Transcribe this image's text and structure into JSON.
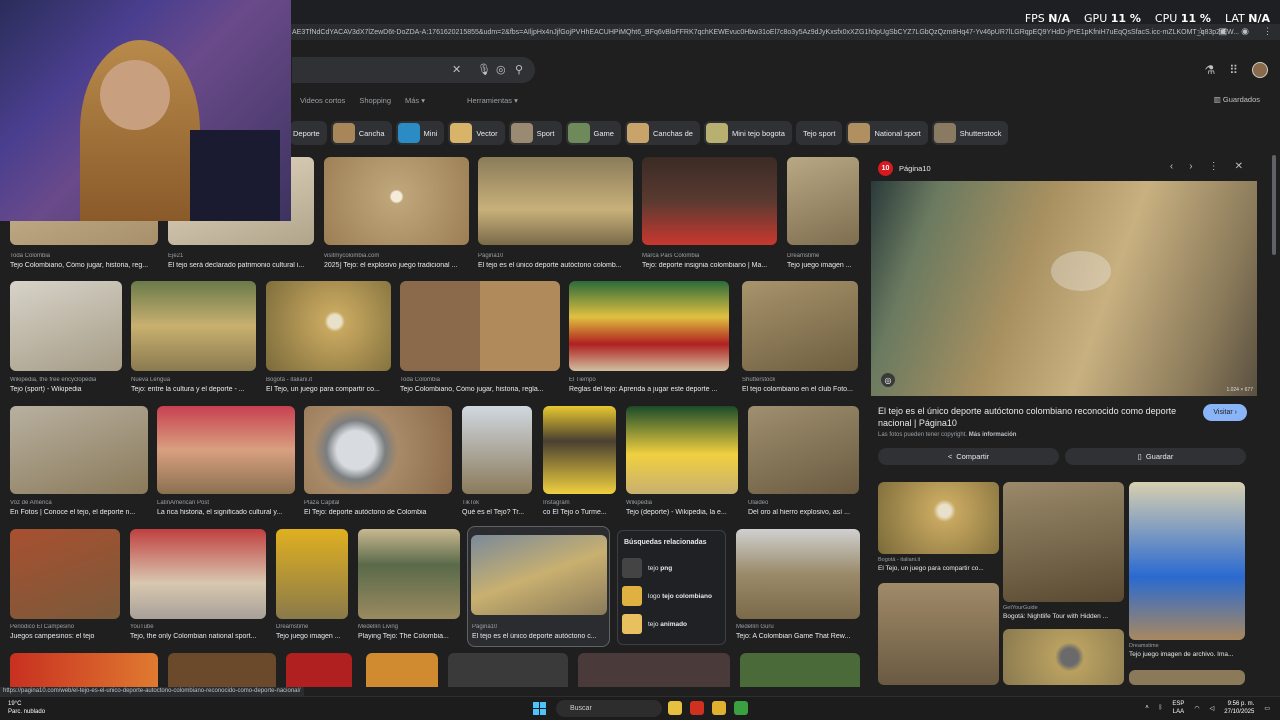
{
  "overlay": {
    "fps_label": "FPS",
    "fps": "N/A",
    "gpu_label": "GPU",
    "gpu": "11 %",
    "cpu_label": "CPU",
    "cpu": "11 %",
    "lat_label": "LAT",
    "lat": "N/A"
  },
  "browser": {
    "url": "AE3TfNdCdYACAV3dX7lZewD6t-DoZDA-A:1761620215855&udm=2&fbs=AIljpHx4nJjfGojPVHhEACUHPiMQht6_BFq6vBloFFRK7qchKEWEvuc0Hbw31oEl7c8o3y5Az9dJyKxsfx0xXZG1h0pUgSbCYZ7LGbQzQzm8Hq47-Yv46pUR7lLGRqpEQ9YHdD-jPrE1pKfniH7uEqQsSfacS.icc-mZLKOMT_q83p2rEW..."
  },
  "search": {
    "nav_tabs": [
      "Videos cortos",
      "Shopping",
      "Más ▾",
      "Herramientas ▾"
    ],
    "saved": "Guardados"
  },
  "chips": [
    "Deporte",
    "Cancha",
    "Mini",
    "Vector",
    "Sport",
    "Game",
    "Canchas de",
    "Mini tejo bogota",
    "Tejo sport",
    "National sport",
    "Shutterstock"
  ],
  "row1": [
    {
      "src": "Toda Colombia",
      "cap": "Tejo Colombiano, Cómo jugar, historia, reg..."
    },
    {
      "src": "Eje21",
      "cap": "El tejo será declarado patrimonio cultural i..."
    },
    {
      "src": "visitmycolombia.com",
      "cap": "2025] Tejo: el explosivo juego tradicional ..."
    },
    {
      "src": "Página10",
      "cap": "El tejo es el único deporte autóctono colomb..."
    },
    {
      "src": "Marca País Colombia",
      "cap": "Tejo: deporte insignia colombiano | Ma..."
    },
    {
      "src": "Dreamstime",
      "cap": "Tejo juego imagen ..."
    }
  ],
  "row2": [
    {
      "src": "Wikipedia, the free encyclopedia",
      "cap": "Tejo (sport) - Wikipedia"
    },
    {
      "src": "Nueva Lengua",
      "cap": "Tejo: entre la cultura y el deporte - ..."
    },
    {
      "src": "Bogotá - italiani.it",
      "cap": "El Tejo, un juego para compartir co..."
    },
    {
      "src": "Toda Colombia",
      "cap": "Tejo Colombiano, Cómo jugar, historia, regla..."
    },
    {
      "src": "El Tiempo",
      "cap": "Reglas del tejo: Aprenda a jugar este deporte ..."
    },
    {
      "src": "Shutterstock",
      "cap": "El tejo colombiano en el club Foto..."
    }
  ],
  "row3": [
    {
      "src": "Voz de América",
      "cap": "En Fotos | Conoce el tejo, el deporte n..."
    },
    {
      "src": "LatinAmerican Post",
      "cap": "La rica historia, el significado cultural y..."
    },
    {
      "src": "Plaza Capital",
      "cap": "El Tejo: deporte autóctono de Colombia"
    },
    {
      "src": "TikTok",
      "cap": "Qué es el Tejo? Tr..."
    },
    {
      "src": "Instagram",
      "cap": "co El Tejo o Turme..."
    },
    {
      "src": "Wikipedia",
      "cap": "Tejo (deporte) - Wikipedia, la e..."
    },
    {
      "src": "Ulaideo",
      "cap": "Del oro al hierro explosivo, así ..."
    }
  ],
  "row4": [
    {
      "src": "Periódico El Campesino",
      "cap": "Juegos campesinos: el tejo"
    },
    {
      "src": "YouTube",
      "cap": "Tejo, the only Colombian national sport..."
    },
    {
      "src": "Dreamstime",
      "cap": "Tejo juego imagen ..."
    },
    {
      "src": "Medellín Living",
      "cap": "Playing Tejo: The Colombia..."
    },
    {
      "src": "Página10",
      "cap": "El tejo es el único deporte autóctono c..."
    },
    {
      "src": "Medellín Guru",
      "cap": "Tejo: A Colombian Game That Rew..."
    }
  ],
  "related": {
    "title": "Búsquedas relacionadas",
    "items": [
      {
        "pre": "tejo",
        "bold": "png"
      },
      {
        "pre": "logo",
        "bold": "tejo colombiano"
      },
      {
        "pre": "tejo",
        "bold": "animado"
      }
    ]
  },
  "panel": {
    "site": "Página10",
    "logo_text": "10",
    "title": "El tejo es el único deporte autóctono colombiano reconocido como deporte nacional | Página10",
    "visit": "Visitar ›",
    "copyright": "Las fotos pueden tener copyright.",
    "more_info": "Más información",
    "share": "Compartir",
    "save": "Guardar",
    "dims": "1.024 × 677",
    "thumbs": [
      {
        "src": "Bogotá - italiani.it",
        "cap": "El Tejo, un juego para compartir co..."
      },
      {
        "src": "GetYourGuide",
        "cap": "Bogotá: Nightlife Tour with Hidden ..."
      },
      {
        "src": "Dreamstime",
        "cap": "Tejo juego imagen de archivo. Ima..."
      }
    ]
  },
  "statusbar": {
    "url": "https://pagina10.com/web/el-tejo-es-el-unico-deporte-autoctono-colombiano-reconocido-como-deporte-nacional/"
  },
  "taskbar": {
    "temp": "19°C",
    "weather": "Parc. nublado",
    "search": "Buscar",
    "lang1": "ESP",
    "lang2": "LAA",
    "time": "9:56 p. m.",
    "date": "27/10/2025"
  }
}
